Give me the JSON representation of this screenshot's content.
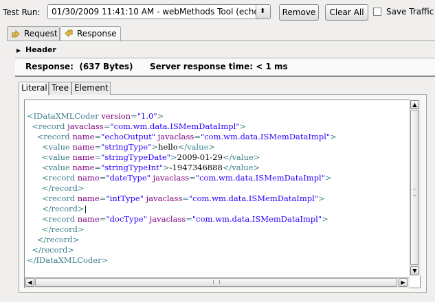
{
  "toolbar": {
    "test_run_label": "Test Run:",
    "selected_run": "01/30/2009 11:41:10 AM - webMethods Tool (echo",
    "remove_label": "Remove",
    "clear_all_label": "Clear All",
    "save_traffic_label": "Save Traffic",
    "save_traffic_checked": false
  },
  "tabs": [
    {
      "label": "Request",
      "active": false,
      "icon": "request-arrow-icon"
    },
    {
      "label": "Response",
      "active": true,
      "icon": "response-arrow-icon"
    }
  ],
  "header_section": {
    "label": "Header",
    "expanded": false
  },
  "response": {
    "size_text": "Response:  (637 Bytes)",
    "time_text": "Server response time: < 1 ms"
  },
  "view_tabs": [
    {
      "label": "Literal",
      "active": true
    },
    {
      "label": "Tree",
      "active": false
    },
    {
      "label": "Element",
      "active": false
    }
  ],
  "xml_lines": [
    [
      {
        "c": "t",
        "s": "<IDataXMLCoder "
      },
      {
        "c": "a",
        "s": "version"
      },
      {
        "c": "t",
        "s": "="
      },
      {
        "c": "v",
        "s": "\"1.0\""
      },
      {
        "c": "t",
        "s": ">"
      }
    ],
    [
      {
        "c": "x",
        "s": "  "
      },
      {
        "c": "t",
        "s": "<record "
      },
      {
        "c": "a",
        "s": "javaclass"
      },
      {
        "c": "t",
        "s": "="
      },
      {
        "c": "v",
        "s": "\"com.wm.data.ISMemDataImpl\""
      },
      {
        "c": "t",
        "s": ">"
      }
    ],
    [
      {
        "c": "x",
        "s": "    "
      },
      {
        "c": "t",
        "s": "<record "
      },
      {
        "c": "a",
        "s": "name"
      },
      {
        "c": "t",
        "s": "="
      },
      {
        "c": "v",
        "s": "\"echoOutput\""
      },
      {
        "c": "t",
        "s": " "
      },
      {
        "c": "a",
        "s": "javaclass"
      },
      {
        "c": "t",
        "s": "="
      },
      {
        "c": "v",
        "s": "\"com.wm.data.ISMemDataImpl\""
      },
      {
        "c": "t",
        "s": ">"
      }
    ],
    [
      {
        "c": "x",
        "s": "      "
      },
      {
        "c": "t",
        "s": "<value "
      },
      {
        "c": "a",
        "s": "name"
      },
      {
        "c": "t",
        "s": "="
      },
      {
        "c": "v",
        "s": "\"stringType\""
      },
      {
        "c": "t",
        "s": ">"
      },
      {
        "c": "x",
        "s": "hello"
      },
      {
        "c": "t",
        "s": "</value>"
      }
    ],
    [
      {
        "c": "x",
        "s": "      "
      },
      {
        "c": "t",
        "s": "<value "
      },
      {
        "c": "a",
        "s": "name"
      },
      {
        "c": "t",
        "s": "="
      },
      {
        "c": "v",
        "s": "\"stringTypeDate\""
      },
      {
        "c": "t",
        "s": ">"
      },
      {
        "c": "x",
        "s": "2009-01-29"
      },
      {
        "c": "t",
        "s": "</value>"
      }
    ],
    [
      {
        "c": "x",
        "s": "      "
      },
      {
        "c": "t",
        "s": "<value "
      },
      {
        "c": "a",
        "s": "name"
      },
      {
        "c": "t",
        "s": "="
      },
      {
        "c": "v",
        "s": "\"stringTypeInt\""
      },
      {
        "c": "t",
        "s": ">"
      },
      {
        "c": "x",
        "s": "-1947346888"
      },
      {
        "c": "t",
        "s": "</value>"
      }
    ],
    [
      {
        "c": "x",
        "s": "      "
      },
      {
        "c": "t",
        "s": "<record "
      },
      {
        "c": "a",
        "s": "name"
      },
      {
        "c": "t",
        "s": "="
      },
      {
        "c": "v",
        "s": "\"dateType\""
      },
      {
        "c": "t",
        "s": " "
      },
      {
        "c": "a",
        "s": "javaclass"
      },
      {
        "c": "t",
        "s": "="
      },
      {
        "c": "v",
        "s": "\"com.wm.data.ISMemDataImpl\""
      },
      {
        "c": "t",
        "s": ">"
      }
    ],
    [
      {
        "c": "x",
        "s": "      "
      },
      {
        "c": "t",
        "s": "</record>"
      }
    ],
    [
      {
        "c": "x",
        "s": "      "
      },
      {
        "c": "t",
        "s": "<record "
      },
      {
        "c": "a",
        "s": "name"
      },
      {
        "c": "t",
        "s": "="
      },
      {
        "c": "v",
        "s": "\"intType\""
      },
      {
        "c": "t",
        "s": " "
      },
      {
        "c": "a",
        "s": "javaclass"
      },
      {
        "c": "t",
        "s": "="
      },
      {
        "c": "v",
        "s": "\"com.wm.data.ISMemDataImpl\""
      },
      {
        "c": "t",
        "s": ">"
      }
    ],
    [
      {
        "c": "x",
        "s": "      "
      },
      {
        "c": "t",
        "s": "</record>"
      },
      {
        "c": "x",
        "s": "|"
      }
    ],
    [
      {
        "c": "x",
        "s": "      "
      },
      {
        "c": "t",
        "s": "<record "
      },
      {
        "c": "a",
        "s": "name"
      },
      {
        "c": "t",
        "s": "="
      },
      {
        "c": "v",
        "s": "\"docType\""
      },
      {
        "c": "t",
        "s": " "
      },
      {
        "c": "a",
        "s": "javaclass"
      },
      {
        "c": "t",
        "s": "="
      },
      {
        "c": "v",
        "s": "\"com.wm.data.ISMemDataImpl\""
      },
      {
        "c": "t",
        "s": ">"
      }
    ],
    [
      {
        "c": "x",
        "s": "      "
      },
      {
        "c": "t",
        "s": "</record>"
      }
    ],
    [
      {
        "c": "x",
        "s": "    "
      },
      {
        "c": "t",
        "s": "</record>"
      }
    ],
    [
      {
        "c": "x",
        "s": "  "
      },
      {
        "c": "t",
        "s": "</record>"
      }
    ],
    [
      {
        "c": "t",
        "s": "</IDataXMLCoder>"
      }
    ]
  ],
  "colors": {
    "tag": "#3c7f8a",
    "attribute": "#7f007f",
    "value": "#2a00ff",
    "text": "#000000"
  }
}
